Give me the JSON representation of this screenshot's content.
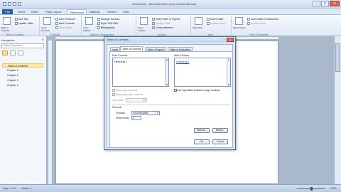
{
  "window": {
    "title": "Document1 - Microsoft Word (non-commercial use)",
    "min_glyph": "–",
    "max_glyph": "□",
    "close_glyph": "✕"
  },
  "tabs": [
    "File",
    "Home",
    "Insert",
    "Page Layout",
    "References",
    "Mailings",
    "Review",
    "View"
  ],
  "ribbon": {
    "toc": {
      "big_button": "Table of Contents",
      "add_text": "Add Text",
      "update_table": "Update Table",
      "group_label": "Table of Contents"
    },
    "footnotes": {
      "big_button": "Insert Footnote",
      "insert_endnote": "Insert Endnote",
      "next_footnote": "Next Footnote",
      "show_notes": "Show Notes",
      "group_label": "Footnotes"
    },
    "citations": {
      "big_button": "Insert Citation",
      "manage_sources": "Manage Sources",
      "style_label": "Style:",
      "style_value": "APA Fifth",
      "bibliography": "Bibliography",
      "group_label": "Citations & Bibliography"
    },
    "captions": {
      "big_button": "Insert Caption",
      "insert_tof": "Insert Table of Figures",
      "update_table": "Update Table",
      "cross_reference": "Cross-reference",
      "group_label": "Captions"
    },
    "index": {
      "big_button": "Mark Entry",
      "insert_index": "Insert Index",
      "update_index": "Update Index",
      "group_label": "Index"
    },
    "toa": {
      "big_button": "Mark Citation",
      "insert_toa": "Insert Table of Authorities",
      "update_table": "Update Table",
      "group_label": "Table of Authorities"
    }
  },
  "nav": {
    "title": "Navigation",
    "close": "✕",
    "search_placeholder": "Search Document",
    "items": [
      "Table of Contents",
      "Chapter 1",
      "Chapter 2",
      "Chapter 3",
      "Chapter 4"
    ]
  },
  "status": {
    "page": "Page: 1 of 1",
    "words": "Words: 4",
    "zoom": "100%"
  },
  "dialog": {
    "title": "Table of Contents",
    "help": "?",
    "close": "✕",
    "tabs": [
      "Index",
      "Table of Contents",
      "Table of Figures",
      "Table of Authorities"
    ],
    "print_preview_label": "Print Preview",
    "print_preview_text": "Heading 1",
    "web_preview_label": "Web Preview",
    "web_preview_text": "Heading 1",
    "show_page_numbers": "Show page numbers",
    "right_align": "Right align page numbers",
    "tab_leader_label": "Tab leader:",
    "tab_leader_value": ".......",
    "use_hyperlinks": "Use hyperlinks instead of page numbers",
    "general_label": "General",
    "formats_label": "Formats:",
    "formats_value": "From template",
    "show_levels_label": "Show levels:",
    "show_levels_value": "3",
    "options_button": "Options...",
    "modify_button": "Modify...",
    "ok_button": "OK",
    "cancel_button": "Cancel"
  }
}
